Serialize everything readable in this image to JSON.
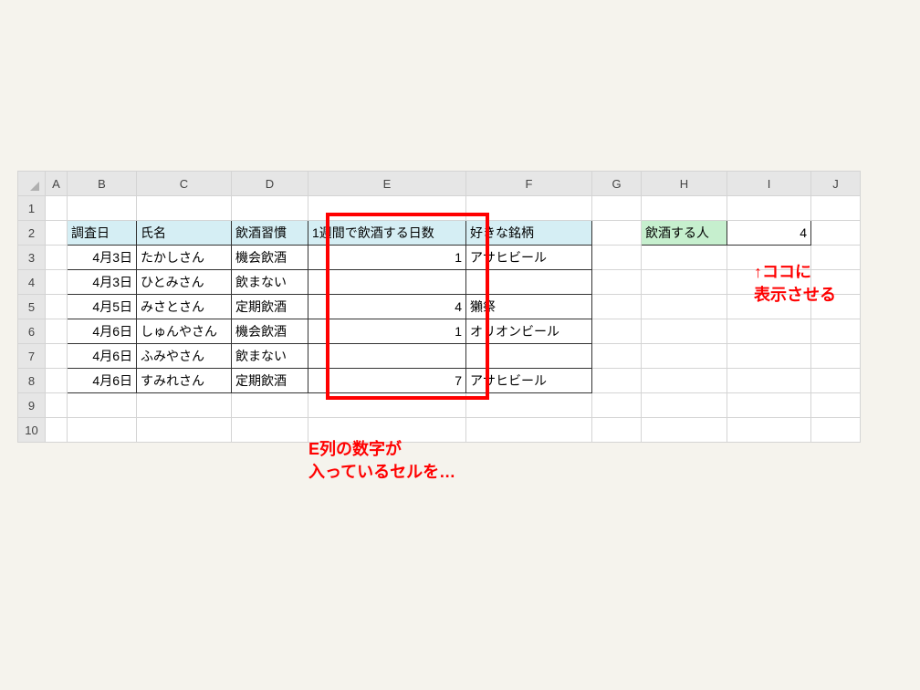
{
  "columns": [
    "A",
    "B",
    "C",
    "D",
    "E",
    "F",
    "G",
    "H",
    "I",
    "J"
  ],
  "row_numbers": [
    "1",
    "2",
    "3",
    "4",
    "5",
    "6",
    "7",
    "8",
    "9",
    "10"
  ],
  "headers": {
    "survey_date": "調査日",
    "name": "氏名",
    "drinking_habit": "飲酒習慣",
    "days_per_week": "1週間で飲酒する日数",
    "favorite_brand": "好きな銘柄"
  },
  "rows": [
    {
      "date": "4月3日",
      "name": "たかしさん",
      "habit": "機会飲酒",
      "days": "1",
      "brand": "アサヒビール"
    },
    {
      "date": "4月3日",
      "name": "ひとみさん",
      "habit": "飲まない",
      "days": "",
      "brand": ""
    },
    {
      "date": "4月5日",
      "name": "みさとさん",
      "habit": "定期飲酒",
      "days": "4",
      "brand": "獺祭"
    },
    {
      "date": "4月6日",
      "name": "しゅんやさん",
      "habit": "機会飲酒",
      "days": "1",
      "brand": "オリオンビール"
    },
    {
      "date": "4月6日",
      "name": "ふみやさん",
      "habit": "飲まない",
      "days": "",
      "brand": ""
    },
    {
      "date": "4月6日",
      "name": "すみれさん",
      "habit": "定期飲酒",
      "days": "7",
      "brand": "アサヒビール"
    }
  ],
  "summary": {
    "label": "飲酒する人",
    "value": "4"
  },
  "annotations": {
    "bottom": "E列の数字が\n入っているセルを…",
    "right": "↑ココに\n表示させる"
  }
}
